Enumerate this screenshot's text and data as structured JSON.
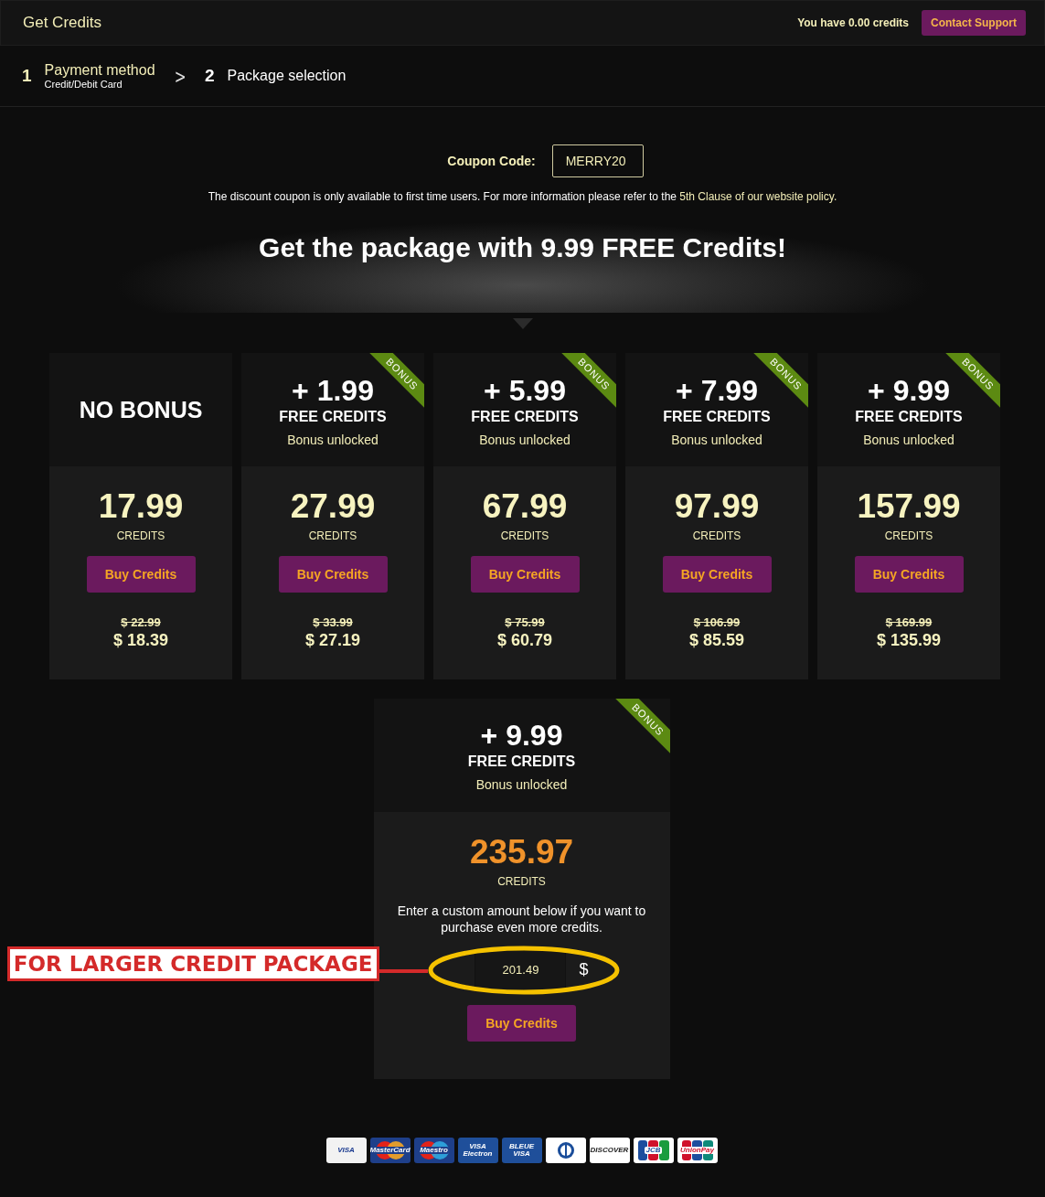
{
  "header": {
    "title": "Get Credits",
    "balance": "You have 0.00 credits",
    "support_button": "Contact Support"
  },
  "steps": [
    {
      "number": "1",
      "label": "Payment method",
      "sublabel": "Credit/Debit Card",
      "selected": false
    },
    {
      "number": "2",
      "label": "Package selection",
      "selected": true
    }
  ],
  "step_separator": ">",
  "coupon": {
    "label": "Coupon Code:",
    "value": "MERRY20"
  },
  "notice": {
    "text": "The discount coupon is only available to first time users. For more information please refer to the ",
    "link": "5th Clause of our website policy."
  },
  "headline": "Get the package with 9.99 FREE Credits!",
  "packages": [
    {
      "kind": "no_bonus",
      "title": "NO BONUS",
      "credits": "17.99",
      "credits_label": "CREDITS",
      "button": "Buy Credits",
      "old_price": "$ 22.99",
      "price": "$ 18.39"
    },
    {
      "kind": "bonus",
      "ribbon": "BONUS",
      "bonus": "+ 1.99",
      "bonus_label": "FREE CREDITS",
      "status": "Bonus unlocked",
      "credits": "27.99",
      "credits_label": "CREDITS",
      "button": "Buy Credits",
      "old_price": "$ 33.99",
      "price": "$ 27.19"
    },
    {
      "kind": "bonus",
      "ribbon": "BONUS",
      "bonus": "+ 5.99",
      "bonus_label": "FREE CREDITS",
      "status": "Bonus unlocked",
      "credits": "67.99",
      "credits_label": "CREDITS",
      "button": "Buy Credits",
      "old_price": "$ 75.99",
      "price": "$ 60.79"
    },
    {
      "kind": "bonus",
      "ribbon": "BONUS",
      "bonus": "+ 7.99",
      "bonus_label": "FREE CREDITS",
      "status": "Bonus unlocked",
      "credits": "97.99",
      "credits_label": "CREDITS",
      "button": "Buy Credits",
      "old_price": "$ 106.99",
      "price": "$ 85.59"
    },
    {
      "kind": "bonus",
      "ribbon": "BONUS",
      "bonus": "+ 9.99",
      "bonus_label": "FREE CREDITS",
      "status": "Bonus unlocked",
      "credits": "157.99",
      "credits_label": "CREDITS",
      "button": "Buy Credits",
      "old_price": "$ 169.99",
      "price": "$ 135.99"
    }
  ],
  "custom_package": {
    "ribbon": "BONUS",
    "bonus": "+ 9.99",
    "bonus_label": "FREE CREDITS",
    "status": "Bonus unlocked",
    "credits": "235.97",
    "credits_label": "CREDITS",
    "description": "Enter a custom amount below if you want to purchase even more credits.",
    "amount": "201.49",
    "currency": "$",
    "button": "Buy Credits"
  },
  "annotation": "FOR LARGER CREDIT PACKAGE",
  "payment_logos": [
    {
      "text": "VISA",
      "kind": "visa"
    },
    {
      "text": "MasterCard",
      "kind": "circles"
    },
    {
      "text": "Maestro",
      "kind": "circles"
    },
    {
      "text": "VISA Electron",
      "kind": "blue"
    },
    {
      "text": "BLEUE VISA",
      "kind": "blue"
    },
    {
      "kind": "diners"
    },
    {
      "text": "DISCOVER",
      "kind": "discover"
    },
    {
      "text": "JCB",
      "kind": "jcb"
    },
    {
      "text": "UnionPay",
      "kind": "unionpay"
    }
  ]
}
